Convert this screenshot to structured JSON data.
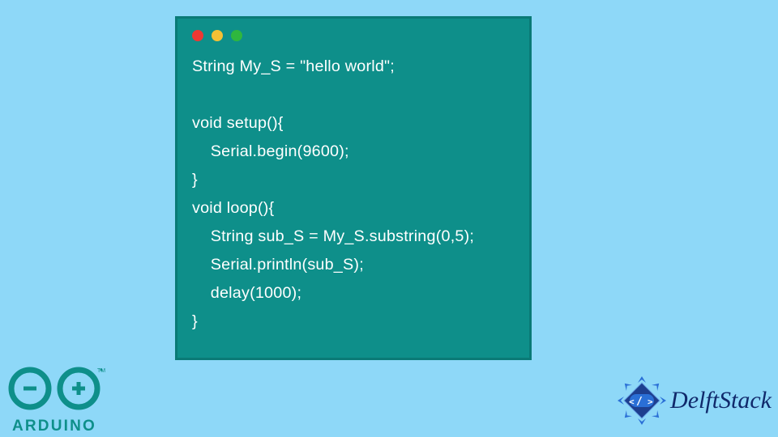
{
  "window": {
    "dots": {
      "red": "#ed3833",
      "yellow": "#f5c035",
      "green": "#2fb73e"
    }
  },
  "code": {
    "text": "String My_S = \"hello world\";\n\nvoid setup(){\n    Serial.begin(9600);\n}\nvoid loop(){\n    String sub_S = My_S.substring(0,5);\n    Serial.println(sub_S);\n    delay(1000);\n}"
  },
  "logos": {
    "arduino_label": "ARDUINO",
    "delft_label": "DelftStack"
  },
  "colors": {
    "bg": "#8ed8f8",
    "window_bg": "#0e8f8a",
    "window_border": "#0a7a76",
    "code_fg": "#ffffff",
    "arduino_teal": "#0e8f8a",
    "delft_navy": "#10296b",
    "badge_blue": "#2a6fd6",
    "badge_fill": "#1d3f8f"
  }
}
